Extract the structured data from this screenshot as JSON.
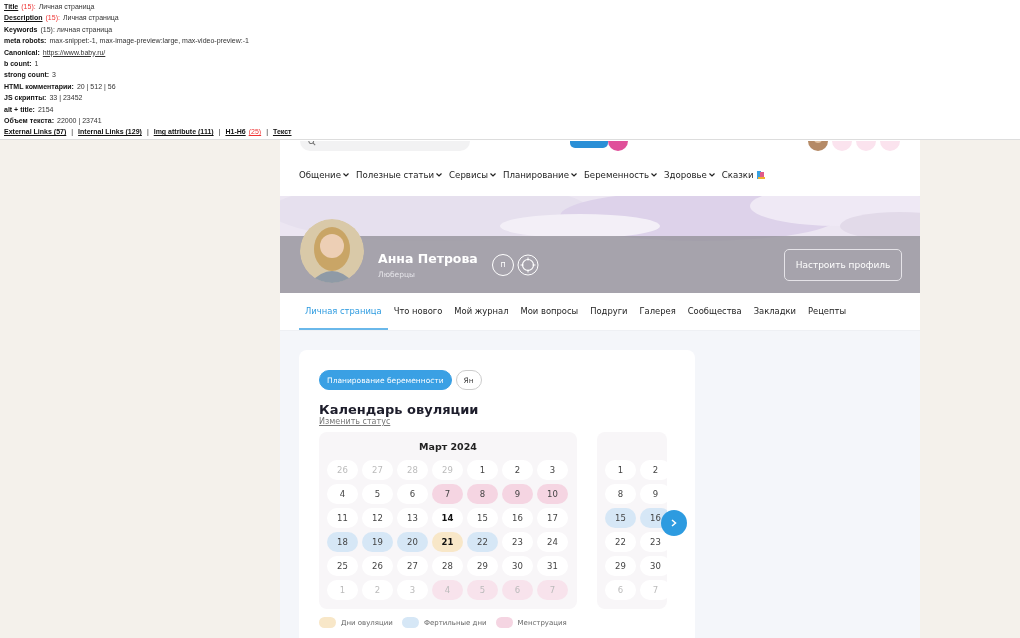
{
  "seo_panel": {
    "lines": [
      {
        "label": "Title",
        "label_link": true,
        "count": "(15):",
        "value": "Личная страница"
      },
      {
        "label": "Description",
        "label_link": true,
        "count": "(15):",
        "value": "Личная страница"
      },
      {
        "label": "Keywords",
        "label_link": false,
        "value": "(15): личная страница"
      },
      {
        "label": "meta robots:",
        "label_link": false,
        "value": "max-snippet:-1, max-image-preview:large, max-video-preview:-1"
      },
      {
        "label": "Canonical:",
        "label_link": false,
        "link": "https://www.baby.ru/"
      },
      {
        "label": "b count:",
        "label_link": false,
        "value": "1"
      },
      {
        "label": "strong count:",
        "label_link": false,
        "value": "3"
      },
      {
        "label": "HTML комментарии:",
        "label_link": false,
        "value": "20 | 512 | 56"
      },
      {
        "label": "JS скрипты:",
        "label_link": false,
        "value": "33 | 23452"
      },
      {
        "label": "alt + title:",
        "label_link": false,
        "value": "2154"
      },
      {
        "label": "Объем текста:",
        "label_link": false,
        "value": "22000 | 23741"
      }
    ],
    "separator": "|",
    "links": [
      {
        "text": "External Links (57)"
      },
      {
        "text": "Internal Links (129)"
      },
      {
        "text": "Img attribute (111)"
      },
      {
        "text": "H1-H6",
        "count": "(25)"
      },
      {
        "text": "Текст"
      }
    ]
  },
  "nav": [
    {
      "label": "Общение",
      "dropdown": true
    },
    {
      "label": "Полезные статьи",
      "dropdown": true
    },
    {
      "label": "Сервисы",
      "dropdown": true
    },
    {
      "label": "Планирование",
      "dropdown": true
    },
    {
      "label": "Беременность",
      "dropdown": true
    },
    {
      "label": "Здоровье",
      "dropdown": true
    },
    {
      "label": "Сказки",
      "dropdown": false
    }
  ],
  "profile": {
    "name": "Анна Петрова",
    "city": "Люберцы",
    "badge": "п",
    "button": "Настроить профиль"
  },
  "tabs": [
    {
      "label": "Личная страница",
      "selected": true
    },
    {
      "label": "Что нового",
      "selected": false
    },
    {
      "label": "Мой журнал",
      "selected": false
    },
    {
      "label": "Мои вопросы",
      "selected": false
    },
    {
      "label": "Подруги",
      "selected": false
    },
    {
      "label": "Галерея",
      "selected": false
    },
    {
      "label": "Сообщества",
      "selected": false
    },
    {
      "label": "Закладки",
      "selected": false
    },
    {
      "label": "Рецепты",
      "selected": false
    }
  ],
  "card": {
    "chips": [
      {
        "label": "Планирование беременности",
        "selected": true
      },
      {
        "label": "Ян",
        "selected": false
      }
    ],
    "title": "Календарь овуляции",
    "link": "Изменить статус",
    "months": [
      {
        "title": "Март 2024",
        "weeks": [
          [
            {
              "day": "26",
              "kind": "plain",
              "outside": true,
              "bold": false
            },
            {
              "day": "27",
              "kind": "plain",
              "outside": true,
              "bold": false
            },
            {
              "day": "28",
              "kind": "plain",
              "outside": true,
              "bold": false
            },
            {
              "day": "29",
              "kind": "plain",
              "outside": true,
              "bold": false
            },
            {
              "day": "1",
              "kind": "plain",
              "outside": false,
              "bold": false
            },
            {
              "day": "2",
              "kind": "plain",
              "outside": false,
              "bold": false
            },
            {
              "day": "3",
              "kind": "plain",
              "outside": false,
              "bold": false
            }
          ],
          [
            {
              "day": "4",
              "kind": "plain",
              "outside": false,
              "bold": false
            },
            {
              "day": "5",
              "kind": "plain",
              "outside": false,
              "bold": false
            },
            {
              "day": "6",
              "kind": "plain",
              "outside": false,
              "bold": false
            },
            {
              "day": "7",
              "kind": "menstruation",
              "outside": false,
              "bold": false
            },
            {
              "day": "8",
              "kind": "menstruation",
              "outside": false,
              "bold": false
            },
            {
              "day": "9",
              "kind": "menstruation",
              "outside": false,
              "bold": false
            },
            {
              "day": "10",
              "kind": "menstruation",
              "outside": false,
              "bold": false
            }
          ],
          [
            {
              "day": "11",
              "kind": "plain",
              "outside": false,
              "bold": false
            },
            {
              "day": "12",
              "kind": "plain",
              "outside": false,
              "bold": false
            },
            {
              "day": "13",
              "kind": "plain",
              "outside": false,
              "bold": false
            },
            {
              "day": "14",
              "kind": "plain",
              "outside": false,
              "bold": true
            },
            {
              "day": "15",
              "kind": "plain",
              "outside": false,
              "bold": false
            },
            {
              "day": "16",
              "kind": "plain",
              "outside": false,
              "bold": false
            },
            {
              "day": "17",
              "kind": "plain",
              "outside": false,
              "bold": false
            }
          ],
          [
            {
              "day": "18",
              "kind": "fertile",
              "outside": false,
              "bold": false
            },
            {
              "day": "19",
              "kind": "fertile",
              "outside": false,
              "bold": false
            },
            {
              "day": "20",
              "kind": "fertile",
              "outside": false,
              "bold": false
            },
            {
              "day": "21",
              "kind": "ovulation",
              "outside": false,
              "bold": true
            },
            {
              "day": "22",
              "kind": "fertile",
              "outside": false,
              "bold": false
            },
            {
              "day": "23",
              "kind": "plain",
              "outside": false,
              "bold": false
            },
            {
              "day": "24",
              "kind": "plain",
              "outside": false,
              "bold": false
            }
          ],
          [
            {
              "day": "25",
              "kind": "plain",
              "outside": false,
              "bold": false
            },
            {
              "day": "26",
              "kind": "plain",
              "outside": false,
              "bold": false
            },
            {
              "day": "27",
              "kind": "plain",
              "outside": false,
              "bold": false
            },
            {
              "day": "28",
              "kind": "plain",
              "outside": false,
              "bold": false
            },
            {
              "day": "29",
              "kind": "plain",
              "outside": false,
              "bold": false
            },
            {
              "day": "30",
              "kind": "plain",
              "outside": false,
              "bold": false
            },
            {
              "day": "31",
              "kind": "plain",
              "outside": false,
              "bold": false
            }
          ],
          [
            {
              "day": "1",
              "kind": "plain",
              "outside": true,
              "bold": false
            },
            {
              "day": "2",
              "kind": "plain",
              "outside": true,
              "bold": false
            },
            {
              "day": "3",
              "kind": "plain",
              "outside": true,
              "bold": false
            },
            {
              "day": "4",
              "kind": "menstruation",
              "outside": true,
              "bold": false
            },
            {
              "day": "5",
              "kind": "menstruation",
              "outside": true,
              "bold": false
            },
            {
              "day": "6",
              "kind": "menstruation",
              "outside": true,
              "bold": false
            },
            {
              "day": "7",
              "kind": "menstruation",
              "outside": true,
              "bold": false
            }
          ]
        ]
      },
      {
        "weeks": [
          [
            {
              "day": "1",
              "kind": "plain",
              "outside": false,
              "bold": false
            },
            {
              "day": "2",
              "kind": "plain",
              "outside": false,
              "bold": false
            }
          ],
          [
            {
              "day": "8",
              "kind": "plain",
              "outside": false,
              "bold": false
            },
            {
              "day": "9",
              "kind": "plain",
              "outside": false,
              "bold": false
            }
          ],
          [
            {
              "day": "15",
              "kind": "fertile",
              "outside": false,
              "bold": false
            },
            {
              "day": "16",
              "kind": "fertile",
              "outside": false,
              "bold": false
            }
          ],
          [
            {
              "day": "22",
              "kind": "plain",
              "outside": false,
              "bold": false
            },
            {
              "day": "23",
              "kind": "plain",
              "outside": false,
              "bold": false
            }
          ],
          [
            {
              "day": "29",
              "kind": "plain",
              "outside": false,
              "bold": false
            },
            {
              "day": "30",
              "kind": "plain",
              "outside": false,
              "bold": false
            }
          ],
          [
            {
              "day": "6",
              "kind": "plain",
              "outside": true,
              "bold": false
            },
            {
              "day": "7",
              "kind": "plain",
              "outside": true,
              "bold": false
            }
          ]
        ]
      }
    ],
    "legend": [
      {
        "label": "Дни овуляции",
        "kind": "ovulation"
      },
      {
        "label": "Фертильные дни",
        "kind": "fertile"
      },
      {
        "label": "Менструация",
        "kind": "menstruation"
      }
    ]
  }
}
